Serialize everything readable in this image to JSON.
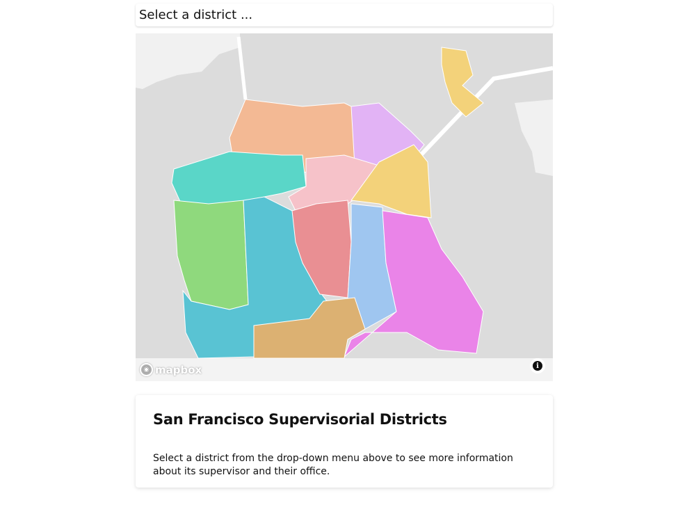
{
  "selector": {
    "placeholder_text": "Select a district ..."
  },
  "map": {
    "attribution_logo": "mapbox",
    "info_icon": "info-icon",
    "districts": [
      {
        "name": "district-1",
        "color": "#5ad6c8"
      },
      {
        "name": "district-2",
        "color": "#f3b994"
      },
      {
        "name": "district-3",
        "color": "#e2b3f5"
      },
      {
        "name": "district-4",
        "color": "#8fd97d"
      },
      {
        "name": "district-5",
        "color": "#f6c2c9"
      },
      {
        "name": "district-6",
        "color": "#f3d27a"
      },
      {
        "name": "district-7",
        "color": "#59c3d3"
      },
      {
        "name": "district-8",
        "color": "#e98f93"
      },
      {
        "name": "district-9",
        "color": "#9fc6f0"
      },
      {
        "name": "district-10",
        "color": "#ea84e8"
      },
      {
        "name": "district-11",
        "color": "#dcb172"
      }
    ]
  },
  "info_card": {
    "title": "San Francisco Supervisorial Districts",
    "description": "Select a district from the drop-down menu above to see more information about its supervisor and their office."
  }
}
